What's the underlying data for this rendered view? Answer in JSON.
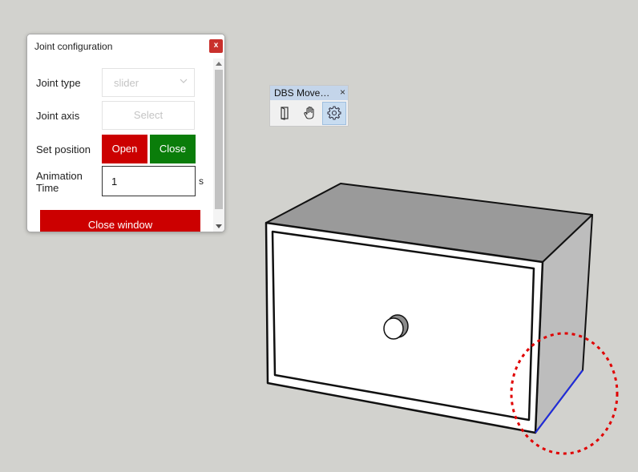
{
  "dialog": {
    "title": "Joint configuration",
    "close_glyph": "x",
    "joint_type_label": "Joint type",
    "joint_type_value": "slider",
    "joint_axis_label": "Joint axis",
    "joint_axis_button": "Select",
    "set_position_label": "Set position",
    "open_label": "Open",
    "close_label": "Close",
    "animation_time_label": "Animation Time",
    "animation_time_value": "1",
    "animation_time_unit": "s",
    "close_window_label": "Close window"
  },
  "toolbar": {
    "title": "DBS Move…",
    "close_glyph": "×",
    "tools": [
      {
        "name": "door-icon",
        "active": false
      },
      {
        "name": "hand-icon",
        "active": false
      },
      {
        "name": "gear-icon",
        "active": true
      }
    ]
  },
  "scene": {
    "background": "#d2d2ce",
    "box_top": "#9a9a9a",
    "box_side": "#bdbdbd",
    "box_front": "#ffffff",
    "selected_edge": "#1f2be0",
    "highlight_circle": "#e00000"
  },
  "colors": {
    "red_button": "#cc0000",
    "green_button": "#0a7d0a",
    "toolbar_title_bg": "#c4d5ea",
    "dialog_close_bg": "#c9302c"
  }
}
